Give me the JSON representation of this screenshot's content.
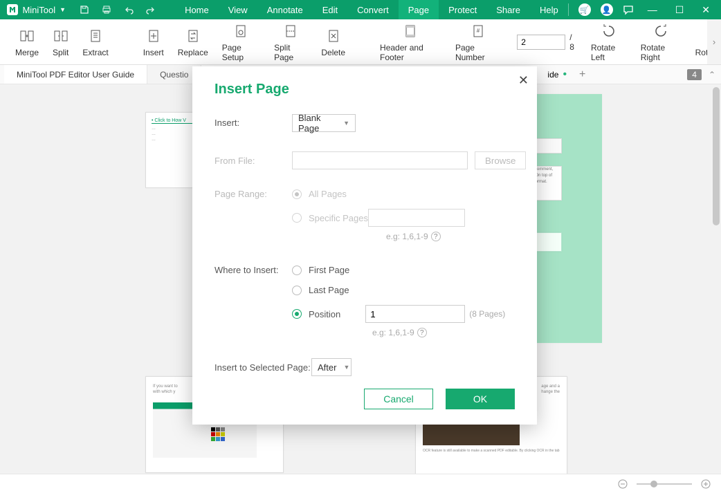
{
  "app": {
    "name": "MiniTool"
  },
  "menu": {
    "home": "Home",
    "view": "View",
    "annotate": "Annotate",
    "edit": "Edit",
    "convert": "Convert",
    "page": "Page",
    "protect": "Protect",
    "share": "Share",
    "help": "Help"
  },
  "ribbon": {
    "merge": "Merge",
    "split": "Split",
    "extract": "Extract",
    "insert": "Insert",
    "replace": "Replace",
    "page_setup": "Page Setup",
    "split_page": "Split Page",
    "delete": "Delete",
    "header_footer": "Header and Footer",
    "page_number": "Page Number",
    "rotate_left": "Rotate Left",
    "rotate_right": "Rotate Right",
    "rotate_cut": "Rota",
    "page_current": "2",
    "page_total": "/ 8"
  },
  "doc_tabs": {
    "tab1": "MiniTool PDF Editor User Guide",
    "tab2_partial": "Questio",
    "tab3_partial": "ide",
    "count": "4"
  },
  "dialog": {
    "title": "Insert Page",
    "insert_label": "Insert:",
    "insert_value": "Blank Page",
    "from_file_label": "From File:",
    "browse": "Browse",
    "page_range_label": "Page Range:",
    "all_pages": "All Pages",
    "specific_pages": "Specific Pages",
    "eg_pages": "e.g: 1,6,1-9",
    "where_label": "Where to Insert:",
    "first_page": "First Page",
    "last_page": "Last Page",
    "position": "Position",
    "position_value": "1",
    "total_pages_note": "(8 Pages)",
    "eg_pos": "e.g: 1,6,1-9",
    "insert_selected_label": "Insert to Selected Page:",
    "insert_selected_value": "After",
    "cancel": "Cancel",
    "ok": "OK"
  },
  "page_thumbs": {
    "lower1_line1": "If you want to",
    "lower1_line2": "with which y",
    "lower2_line1": "age and a",
    "lower2_line2": "hange the",
    "caption": "OCR feature is still available to make a scanned PDF editable. By clicking OCR in the tab"
  },
  "colors": {
    "brand": "#0b9e6a",
    "accent": "#17a96f"
  }
}
